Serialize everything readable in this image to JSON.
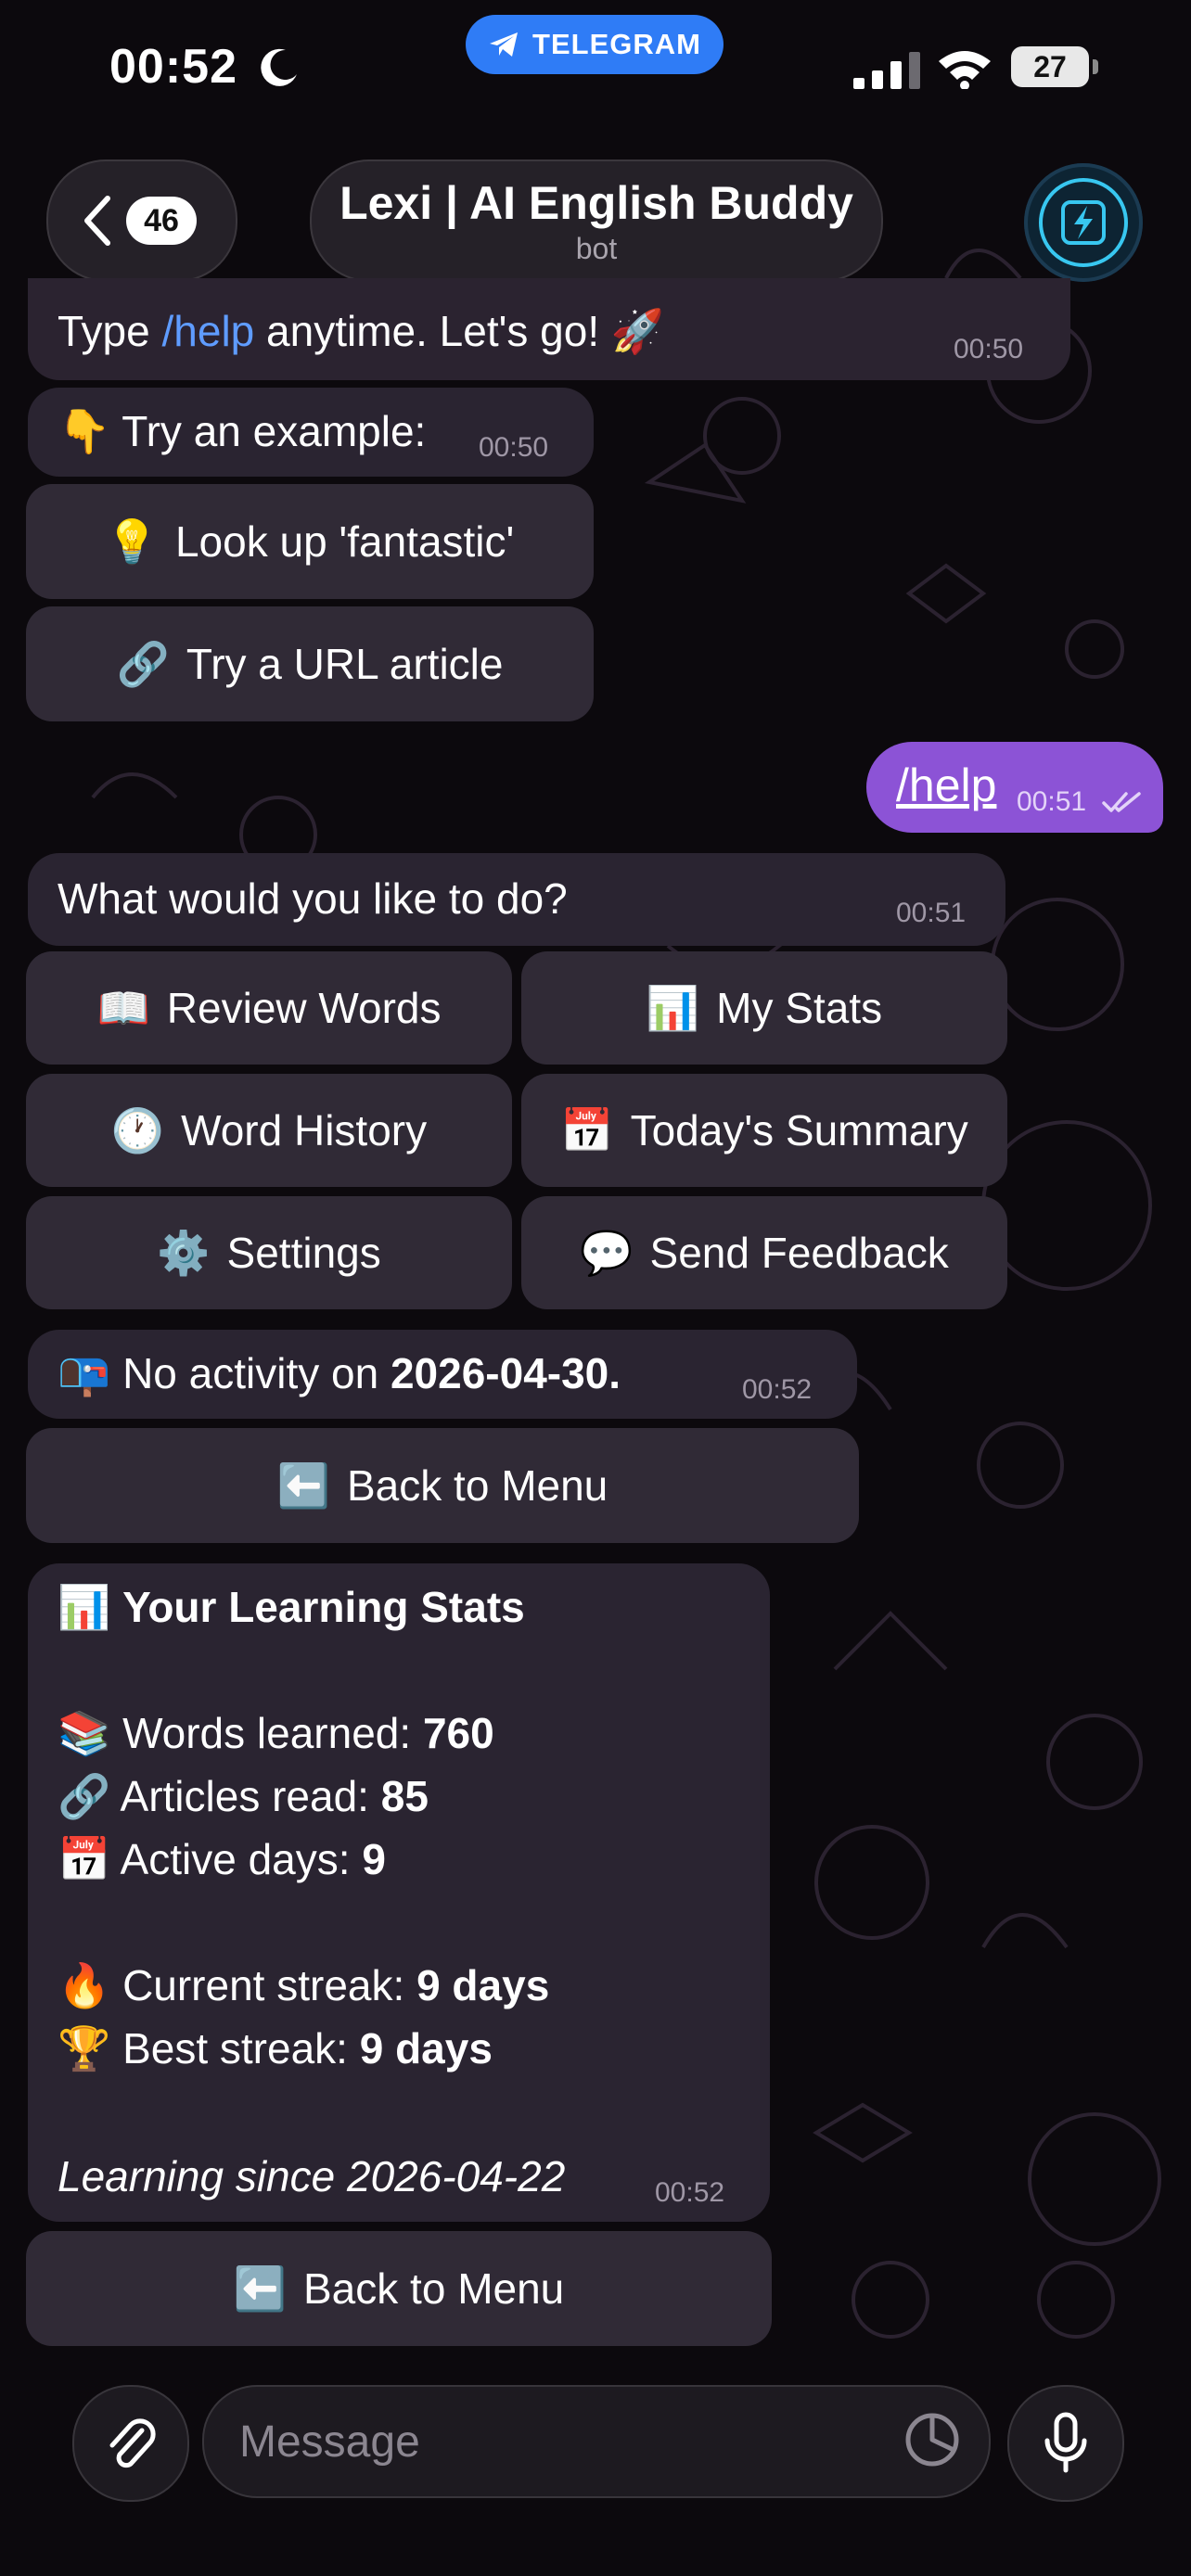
{
  "status_bar": {
    "time": "00:52",
    "app_pill": "TELEGRAM",
    "battery": "27"
  },
  "header": {
    "back_count": "46",
    "chat_name": "Lexi | AI English Buddy",
    "chat_subtitle": "bot"
  },
  "messages": {
    "intro_tail": {
      "prefix": "Type ",
      "command": "/help",
      "suffix": " anytime. Let's go! 🚀",
      "time": "00:50"
    },
    "example": {
      "text": "👇 Try an example:",
      "time": "00:50"
    },
    "example_buttons": [
      {
        "icon": "💡",
        "label": "Look up 'fantastic'"
      },
      {
        "icon": "🔗",
        "label": "Try a URL article"
      }
    ],
    "outgoing": {
      "text": "/help",
      "time": "00:51"
    },
    "menu_prompt": {
      "text": "What would you like to do?",
      "time": "00:51"
    },
    "menu_buttons": [
      {
        "icon": "📖",
        "label": "Review Words"
      },
      {
        "icon": "📊",
        "label": "My Stats"
      },
      {
        "icon": "🕐",
        "label": "Word History"
      },
      {
        "icon": "📅",
        "label": "Today's Summary"
      },
      {
        "icon": "⚙️",
        "label": "Settings"
      },
      {
        "icon": "💬",
        "label": "Send Feedback"
      }
    ],
    "no_activity": {
      "icon": "📭",
      "text": "No activity on ",
      "date": "2026-04-30.",
      "time": "00:52"
    },
    "back_button_1": {
      "icon": "⬅️",
      "label": "Back to Menu"
    },
    "stats": {
      "title_icon": "📊",
      "title": "Your Learning Stats",
      "words_icon": "📚",
      "words_label": "Words learned: ",
      "words_value": "760",
      "articles_icon": "🔗",
      "articles_label": "Articles read: ",
      "articles_value": "85",
      "days_icon": "📅",
      "days_label": "Active days: ",
      "days_value": "9",
      "streak_icon": "🔥",
      "streak_label": "Current streak: ",
      "streak_value": "9 days",
      "best_icon": "🏆",
      "best_label": "Best streak: ",
      "best_value": "9 days",
      "since": "Learning since 2026-04-22",
      "time": "00:52"
    },
    "back_button_2": {
      "icon": "⬅️",
      "label": "Back to Menu"
    }
  },
  "composer": {
    "placeholder": "Message"
  },
  "colors": {
    "outgoing_bubble": "#8c53d6",
    "link": "#5f9cff",
    "telegram_pill": "#2f7cf6"
  }
}
